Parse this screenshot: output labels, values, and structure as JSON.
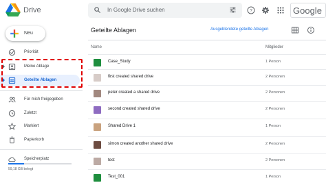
{
  "header": {
    "app_title": "Drive",
    "search_placeholder": "In Google Drive suchen",
    "brand": "Google"
  },
  "sidebar": {
    "new_label": "Neu",
    "items": [
      {
        "label": "Priorität",
        "icon": "priority-icon"
      },
      {
        "label": "Meine Ablage",
        "icon": "my-drive-icon"
      },
      {
        "label": "Geteilte Ablagen",
        "icon": "shared-drives-icon",
        "active": true
      },
      {
        "label": "Für mich freigegeben",
        "icon": "shared-with-me-icon"
      },
      {
        "label": "Zuletzt",
        "icon": "clock-icon"
      },
      {
        "label": "Markiert",
        "icon": "star-icon"
      },
      {
        "label": "Papierkorb",
        "icon": "trash-icon"
      },
      {
        "label": "Speicherplatz",
        "icon": "cloud-icon"
      }
    ],
    "storage_used": "59,18 GB belegt",
    "storage_fraction": 0.25
  },
  "main": {
    "title": "Geteilte Ablagen",
    "hidden_link": "Ausgeblendete geteilte Ablagen",
    "columns": {
      "name": "Name",
      "members": "Mitglieder"
    },
    "rows": [
      {
        "name": "Case_Study",
        "members": "1 Person",
        "color": "#1e8e3e"
      },
      {
        "name": "first created shared drive",
        "members": "2 Personen",
        "color": "#d7ccc8"
      },
      {
        "name": "peter created a shared drive",
        "members": "2 Personen",
        "color": "#a1887f"
      },
      {
        "name": "second created shared drive",
        "members": "2 Personen",
        "color": "#8e6cc1"
      },
      {
        "name": "Shared Drive 1",
        "members": "1 Person",
        "color": "#c9a27e"
      },
      {
        "name": "simon created another shared drive",
        "members": "2 Personen",
        "color": "#6d4c41"
      },
      {
        "name": "test",
        "members": "2 Personen",
        "color": "#bcaaa4"
      },
      {
        "name": "Test_001",
        "members": "1 Person",
        "color": "#1e8e3e"
      }
    ]
  },
  "colors": {
    "accent": "#1a73e8",
    "highlight": "#e00000",
    "active_bg": "#e8f0fe"
  }
}
